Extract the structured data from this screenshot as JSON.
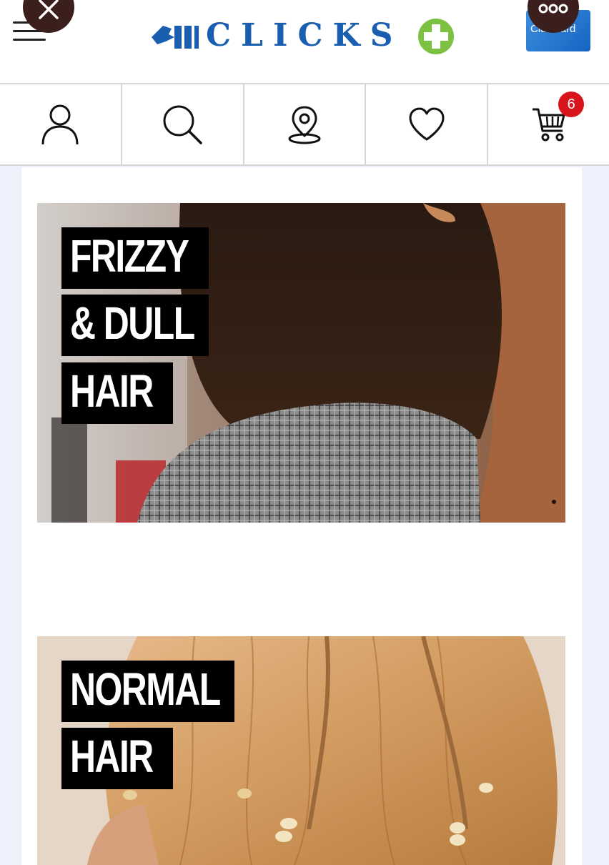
{
  "header": {
    "logo_text": "CLICKS",
    "menu_icon": "hamburger-icon",
    "close_icon": "close-icon",
    "more_icon": "more-horizontal-icon",
    "clubcard_label": "ClubCard"
  },
  "iconbar": {
    "items": [
      {
        "name": "account",
        "icon": "user-icon"
      },
      {
        "name": "search",
        "icon": "search-icon"
      },
      {
        "name": "store-locator",
        "icon": "location-pin-icon"
      },
      {
        "name": "wishlist",
        "icon": "heart-icon"
      },
      {
        "name": "cart",
        "icon": "cart-icon"
      }
    ],
    "cart_count": "6"
  },
  "tiles": [
    {
      "lines": [
        "FRIZZY",
        "& DULL",
        "HAIR"
      ]
    },
    {
      "lines": [
        "NORMAL",
        "HAIR"
      ]
    }
  ],
  "colors": {
    "brand_blue": "#1a5eb0",
    "brand_green": "#7dc142",
    "badge_red": "#d8141c",
    "overlay_dark": "#3b1f1d"
  }
}
